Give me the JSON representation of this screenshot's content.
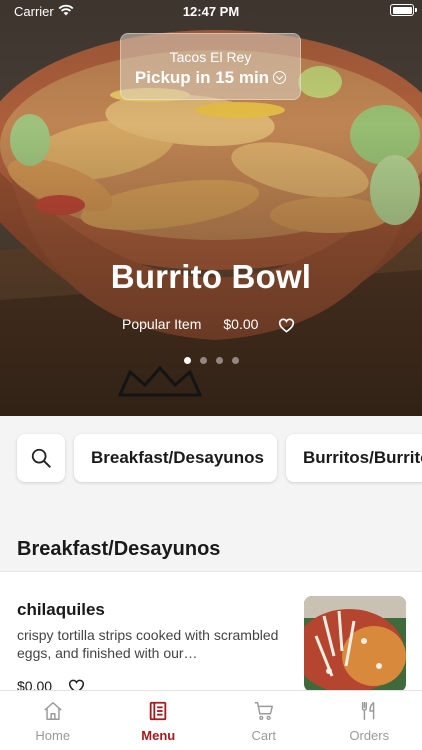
{
  "status_bar": {
    "carrier": "Carrier",
    "time": "12:47 PM"
  },
  "pickup": {
    "restaurant": "Tacos El Rey",
    "time_label": "Pickup in 15 min"
  },
  "hero": {
    "title": "Burrito Bowl",
    "tag": "Popular Item",
    "price": "$0.00",
    "carousel": {
      "count": 4,
      "active_index": 0
    }
  },
  "categories": [
    "Breakfast/Desayunos",
    "Burritos/Burritos"
  ],
  "section": {
    "title": "Breakfast/Desayunos"
  },
  "items": [
    {
      "name": "chilaquiles",
      "description": "crispy tortilla strips cooked with scrambled eggs, and finished with our…",
      "price": "$0.00"
    }
  ],
  "tabs": [
    {
      "label": "Home",
      "icon": "home-icon"
    },
    {
      "label": "Menu",
      "icon": "menu-icon",
      "active": true
    },
    {
      "label": "Cart",
      "icon": "cart-icon"
    },
    {
      "label": "Orders",
      "icon": "orders-icon"
    }
  ],
  "colors": {
    "accent": "#a31b1b",
    "inactive": "#9a9a9a"
  }
}
